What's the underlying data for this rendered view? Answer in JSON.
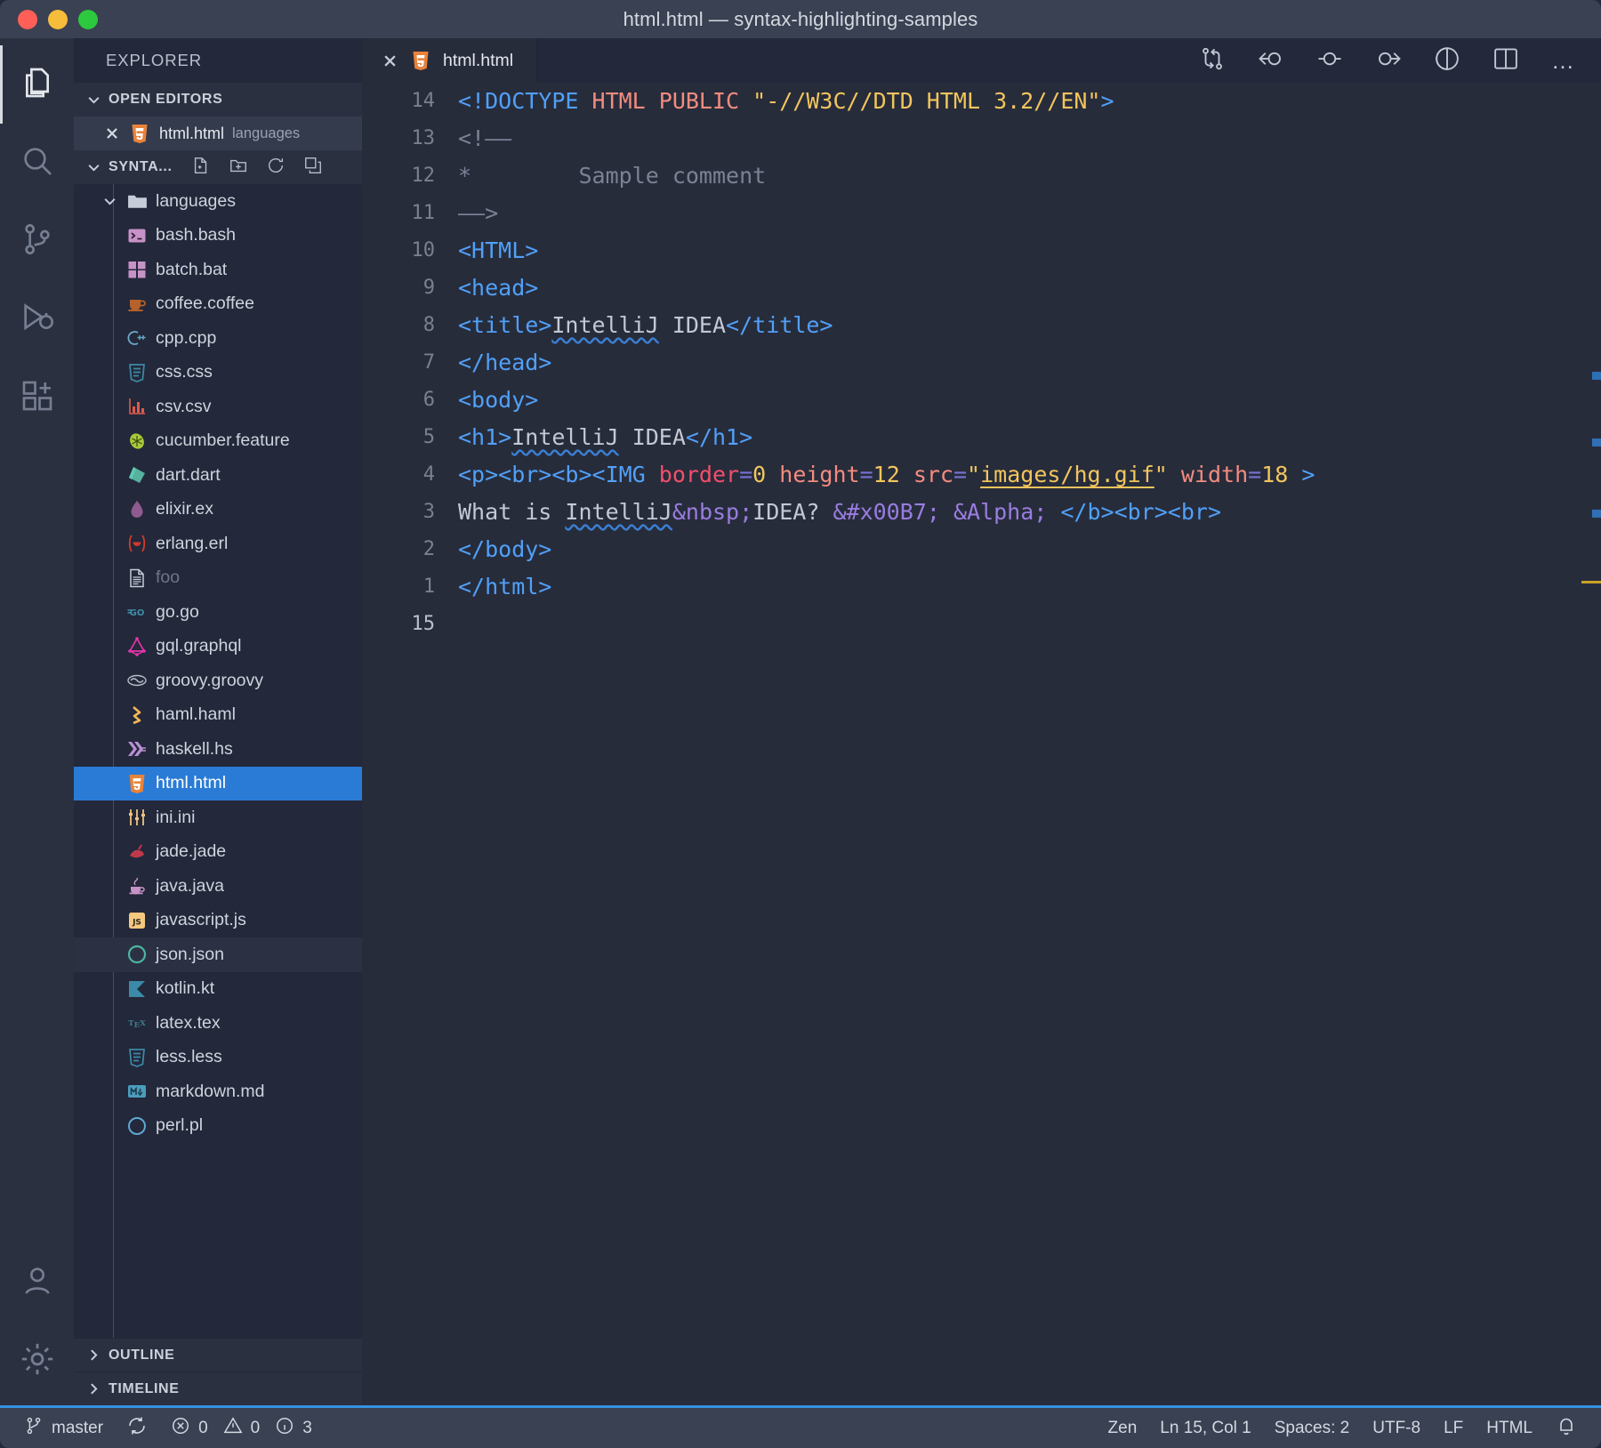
{
  "window": {
    "title": "html.html — syntax-highlighting-samples",
    "traffic_lights": [
      "close-red",
      "minimize-yellow",
      "maximize-green"
    ]
  },
  "activity_bar": {
    "items": [
      {
        "name": "explorer",
        "icon": "files-icon",
        "active": true
      },
      {
        "name": "search",
        "icon": "search-icon",
        "active": false
      },
      {
        "name": "source-control",
        "icon": "source-control-icon",
        "active": false
      },
      {
        "name": "run-and-debug",
        "icon": "run-debug-icon",
        "active": false
      },
      {
        "name": "extensions",
        "icon": "extensions-icon",
        "active": false
      }
    ],
    "bottom_items": [
      {
        "name": "accounts",
        "icon": "account-icon"
      },
      {
        "name": "manage",
        "icon": "gear-icon"
      }
    ]
  },
  "sidebar": {
    "title": "EXPLORER",
    "open_editors": {
      "header": "OPEN EDITORS",
      "items": [
        {
          "name": "html.html",
          "path": "languages",
          "icon": "html5-icon",
          "active": true
        }
      ]
    },
    "project": {
      "header": "SYNTA...",
      "actions": [
        "new-file-icon",
        "new-folder-icon",
        "refresh-icon",
        "collapse-all-icon"
      ],
      "root": {
        "label": "languages",
        "icon": "folder-icon",
        "expanded": true
      },
      "files": [
        {
          "label": "bash.bash",
          "icon": "bash",
          "color": "#c792c7"
        },
        {
          "label": "batch.bat",
          "icon": "batch",
          "color": "#c792c7"
        },
        {
          "label": "coffee.coffee",
          "icon": "coffee",
          "color": "#b5622b"
        },
        {
          "label": "cpp.cpp",
          "icon": "cpp",
          "color": "#6aa9c9"
        },
        {
          "label": "css.css",
          "icon": "css",
          "color": "#3b8ba8"
        },
        {
          "label": "csv.csv",
          "icon": "csv",
          "color": "#e05a4a"
        },
        {
          "label": "cucumber.feature",
          "icon": "cucumber",
          "color": "#a8c93a"
        },
        {
          "label": "dart.dart",
          "icon": "dart",
          "color": "#5fc9b0"
        },
        {
          "label": "elixir.ex",
          "icon": "elixir",
          "color": "#8f5a8f"
        },
        {
          "label": "erlang.erl",
          "icon": "erlang",
          "color": "#d33a2c"
        },
        {
          "label": "foo",
          "icon": "plain-file",
          "color": "#c6ccd8",
          "dimmed": true
        },
        {
          "label": "go.go",
          "icon": "go",
          "color": "#3d8fa8"
        },
        {
          "label": "gql.graphql",
          "icon": "graphql",
          "color": "#e535ab"
        },
        {
          "label": "groovy.groovy",
          "icon": "groovy",
          "color": "#b7bdc9"
        },
        {
          "label": "haml.haml",
          "icon": "haml",
          "color": "#f0b755"
        },
        {
          "label": "haskell.hs",
          "icon": "haskell",
          "color": "#b990d6"
        },
        {
          "label": "html.html",
          "icon": "html5",
          "color": "#e8833a",
          "selected": true
        },
        {
          "label": "ini.ini",
          "icon": "ini",
          "color": "#f0c37e"
        },
        {
          "label": "jade.jade",
          "icon": "jade",
          "color": "#c0394b"
        },
        {
          "label": "java.java",
          "icon": "java",
          "color": "#c792c7"
        },
        {
          "label": "javascript.js",
          "icon": "js",
          "color": "#f5c87f"
        },
        {
          "label": "json.json",
          "icon": "json",
          "color": "#4fb3a0",
          "hovered": true
        },
        {
          "label": "kotlin.kt",
          "icon": "kotlin",
          "color": "#3b8ba8"
        },
        {
          "label": "latex.tex",
          "icon": "latex",
          "color": "#3b7f91"
        },
        {
          "label": "less.less",
          "icon": "less",
          "color": "#3b8ba8"
        },
        {
          "label": "markdown.md",
          "icon": "markdown",
          "color": "#4a9dbd"
        },
        {
          "label": "perl.pl",
          "icon": "perl",
          "color": "#5fa8d3"
        }
      ]
    },
    "footer": [
      {
        "label": "OUTLINE",
        "name": "outline"
      },
      {
        "label": "TIMELINE",
        "name": "timeline"
      }
    ]
  },
  "editor": {
    "tab": {
      "label": "html.html",
      "icon": "html5-icon"
    },
    "toolbar_icons": [
      "split-compare-icon",
      "go-back-change-icon",
      "current-change-icon",
      "go-forward-change-icon",
      "preview-icon",
      "split-editor-icon",
      "more-actions-icon"
    ],
    "more_actions": "…",
    "line_numbers": [
      "14",
      "13",
      "12",
      "11",
      "10",
      "9",
      "8",
      "7",
      "6",
      "5",
      "4",
      "3",
      "2",
      "1",
      "15"
    ],
    "current_line_number": "15",
    "lines": [
      {
        "n": "14",
        "tokens": [
          {
            "t": "<!DOCTYPE ",
            "c": "t-tag"
          },
          {
            "t": "HTML PUBLIC ",
            "c": "t-attr"
          },
          {
            "t": "\"-//W3C//DTD HTML 3.2//EN\"",
            "c": "t-str"
          },
          {
            "t": ">",
            "c": "t-tag"
          }
        ]
      },
      {
        "n": "13",
        "tokens": [
          {
            "t": "<!——",
            "c": "t-com"
          }
        ]
      },
      {
        "n": "12",
        "tokens": [
          {
            "t": "*        Sample comment",
            "c": "t-com"
          }
        ]
      },
      {
        "n": "11",
        "tokens": [
          {
            "t": "——>",
            "c": "t-com"
          }
        ]
      },
      {
        "n": "10",
        "tokens": [
          {
            "t": "<HTML>",
            "c": "t-tag"
          }
        ]
      },
      {
        "n": "9",
        "tokens": [
          {
            "t": "<head>",
            "c": "t-tag"
          }
        ]
      },
      {
        "n": "8",
        "tokens": [
          {
            "t": "<title>",
            "c": "t-tag"
          },
          {
            "t": "IntelliJ",
            "c": "t-txt spell"
          },
          {
            "t": " IDEA",
            "c": "t-txt"
          },
          {
            "t": "</title>",
            "c": "t-tag"
          }
        ]
      },
      {
        "n": "7",
        "tokens": [
          {
            "t": "</head>",
            "c": "t-tag"
          }
        ]
      },
      {
        "n": "6",
        "tokens": [
          {
            "t": "<body>",
            "c": "t-tag"
          }
        ]
      },
      {
        "n": "5",
        "tokens": [
          {
            "t": "<h1>",
            "c": "t-tag"
          },
          {
            "t": "IntelliJ",
            "c": "t-txt spell"
          },
          {
            "t": " IDEA",
            "c": "t-txt"
          },
          {
            "t": "</h1>",
            "c": "t-tag"
          }
        ]
      },
      {
        "n": "4",
        "tokens": [
          {
            "t": "<p><br><b><IMG ",
            "c": "t-tag"
          },
          {
            "t": "border",
            "c": "t-attr2"
          },
          {
            "t": "=",
            "c": "t-eq"
          },
          {
            "t": "0",
            "c": "t-val"
          },
          {
            "t": " ",
            "c": "t-txt"
          },
          {
            "t": "height",
            "c": "t-attr"
          },
          {
            "t": "=",
            "c": "t-eq"
          },
          {
            "t": "12",
            "c": "t-val"
          },
          {
            "t": " ",
            "c": "t-txt"
          },
          {
            "t": "src",
            "c": "t-attr"
          },
          {
            "t": "=",
            "c": "t-eq"
          },
          {
            "t": "\"",
            "c": "t-str"
          },
          {
            "t": "images/hg.gif",
            "c": "t-str-u"
          },
          {
            "t": "\"",
            "c": "t-str"
          },
          {
            "t": " ",
            "c": "t-txt"
          },
          {
            "t": "width",
            "c": "t-attr"
          },
          {
            "t": "=",
            "c": "t-eq"
          },
          {
            "t": "18",
            "c": "t-val"
          },
          {
            "t": " ",
            "c": "t-txt"
          },
          {
            "t": ">",
            "c": "t-tag"
          }
        ]
      },
      {
        "n": "3",
        "tokens": [
          {
            "t": "What is ",
            "c": "t-txt"
          },
          {
            "t": "IntelliJ",
            "c": "t-txt spell"
          },
          {
            "t": "&nbsp;",
            "c": "t-ent"
          },
          {
            "t": "IDEA? ",
            "c": "t-txt"
          },
          {
            "t": "&#x00B7;",
            "c": "t-ent"
          },
          {
            "t": " ",
            "c": "t-txt"
          },
          {
            "t": "&Alpha;",
            "c": "t-ent"
          },
          {
            "t": " ",
            "c": "t-txt"
          },
          {
            "t": "</b><br><br>",
            "c": "t-tag"
          }
        ]
      },
      {
        "n": "2",
        "tokens": [
          {
            "t": "</body>",
            "c": "t-tag"
          }
        ]
      },
      {
        "n": "1",
        "tokens": [
          {
            "t": "</html>",
            "c": "t-tag"
          }
        ]
      },
      {
        "n": "15",
        "tokens": [
          {
            "t": "",
            "c": "t-txt"
          }
        ]
      }
    ]
  },
  "status_bar": {
    "left": [
      {
        "name": "branch",
        "icon": "source-control-icon",
        "label": "master"
      },
      {
        "name": "sync",
        "icon": "sync-icon",
        "label": ""
      },
      {
        "name": "errors",
        "icon": "error-icon",
        "label": "0"
      },
      {
        "name": "warnings",
        "icon": "warning-icon",
        "label": "0"
      },
      {
        "name": "infos",
        "icon": "info-icon",
        "label": "3"
      }
    ],
    "right": [
      {
        "name": "zen-mode",
        "label": "Zen"
      },
      {
        "name": "cursor-position",
        "label": "Ln 15, Col 1"
      },
      {
        "name": "indentation",
        "label": "Spaces: 2"
      },
      {
        "name": "encoding",
        "label": "UTF-8"
      },
      {
        "name": "eol",
        "label": "LF"
      },
      {
        "name": "language-mode",
        "label": "HTML"
      },
      {
        "name": "notifications",
        "icon": "bell-icon",
        "label": ""
      }
    ]
  },
  "colors": {
    "accent": "#3592e0",
    "selection": "#2a7bd5",
    "editor_bg": "#272c3b",
    "sidebar_bg": "#23283a",
    "titlebar_bg": "#3a4152"
  }
}
